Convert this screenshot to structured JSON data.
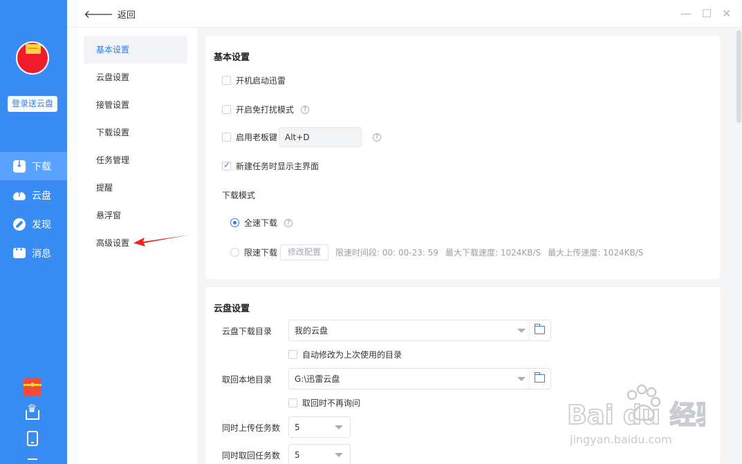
{
  "sidebar": {
    "login_label": "登录送云盘",
    "nav": [
      {
        "label": "下载",
        "icon": "download-icon"
      },
      {
        "label": "云盘",
        "icon": "cloud-icon"
      },
      {
        "label": "发现",
        "icon": "compass-icon"
      },
      {
        "label": "消息",
        "icon": "message-icon"
      }
    ],
    "active_nav": 0,
    "accent": "#3a8cf5"
  },
  "header": {
    "back_label": "返回",
    "window_controls": [
      "minimize-icon",
      "maximize-icon",
      "close-icon"
    ]
  },
  "submenu": {
    "items": [
      "基本设置",
      "云盘设置",
      "接管设置",
      "下载设置",
      "任务管理",
      "提醒",
      "悬浮窗",
      "高级设置"
    ],
    "active": 0
  },
  "basic": {
    "title": "基本设置",
    "startup_label": "开机启动迅雷",
    "dnd_label": "开启免打扰模式",
    "boss_key_label": "启用老板键",
    "boss_key_value": "Alt+D",
    "show_main_label": "新建任务时显示主界面",
    "download_mode_title": "下载模式",
    "full_speed_label": "全速下载",
    "limit_label": "限速下载",
    "modify_config_label": "修改配置",
    "limit_time_text": "限速时间段:  00: 00-23: 59",
    "max_download_text": "最大下载速度: 1024KB/S",
    "max_upload_text": "最大上传速度: 1024KB/S"
  },
  "cloud": {
    "title": "云盘设置",
    "download_dir_label": "云盘下载目录",
    "download_dir_value": "我的云盘",
    "auto_modify_label": "自动修改为上次使用的目录",
    "local_dir_label": "取回本地目录",
    "local_dir_value": "G:\\迅雷云盘",
    "no_ask_label": "取回时不再询问",
    "upload_tasks_label": "同时上传任务数",
    "upload_tasks_value": "5",
    "retrieve_tasks_label": "同时取回任务数",
    "retrieve_tasks_value": "5"
  },
  "watermark": {
    "text": "Bai du 经验",
    "url": "jingyan.baidu.com"
  }
}
